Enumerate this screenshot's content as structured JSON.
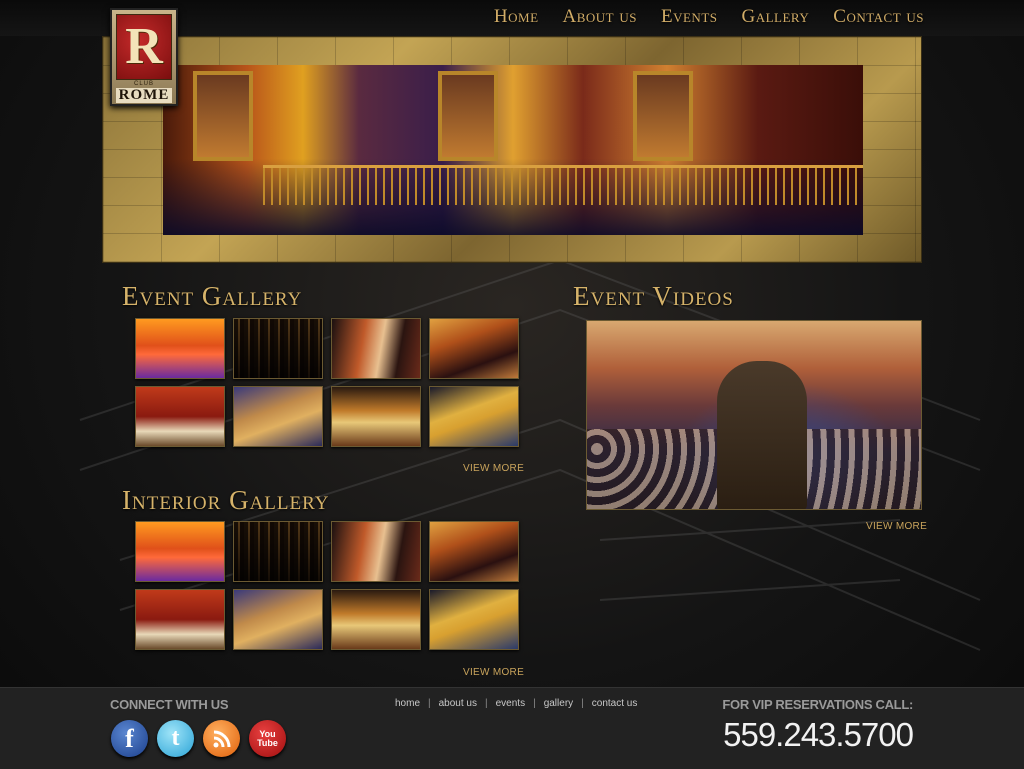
{
  "nav": {
    "items": [
      "Home",
      "About us",
      "Events",
      "Gallery",
      "Contact us"
    ]
  },
  "logo": {
    "letter": "R",
    "small": "CLUB",
    "word": "ROME"
  },
  "event_gallery": {
    "title": "Event Gallery",
    "view_more": "VIEW MORE"
  },
  "interior_gallery": {
    "title": "Interior Gallery",
    "view_more": "VIEW MORE"
  },
  "event_videos": {
    "title": "Event Videos",
    "view_more": "VIEW MORE"
  },
  "footer": {
    "connect_label": "CONNECT WITH US",
    "social": {
      "facebook": "f",
      "twitter": "t",
      "youtube_top": "You",
      "youtube_bottom": "Tube"
    },
    "links": [
      "home",
      "about us",
      "events",
      "gallery",
      "contact us"
    ],
    "vip_label": "FOR VIP RESERVATIONS CALL:",
    "phone": "559.243.5700"
  },
  "colors": {
    "gold": "#d6b36a",
    "footer_bg": "#222222"
  }
}
